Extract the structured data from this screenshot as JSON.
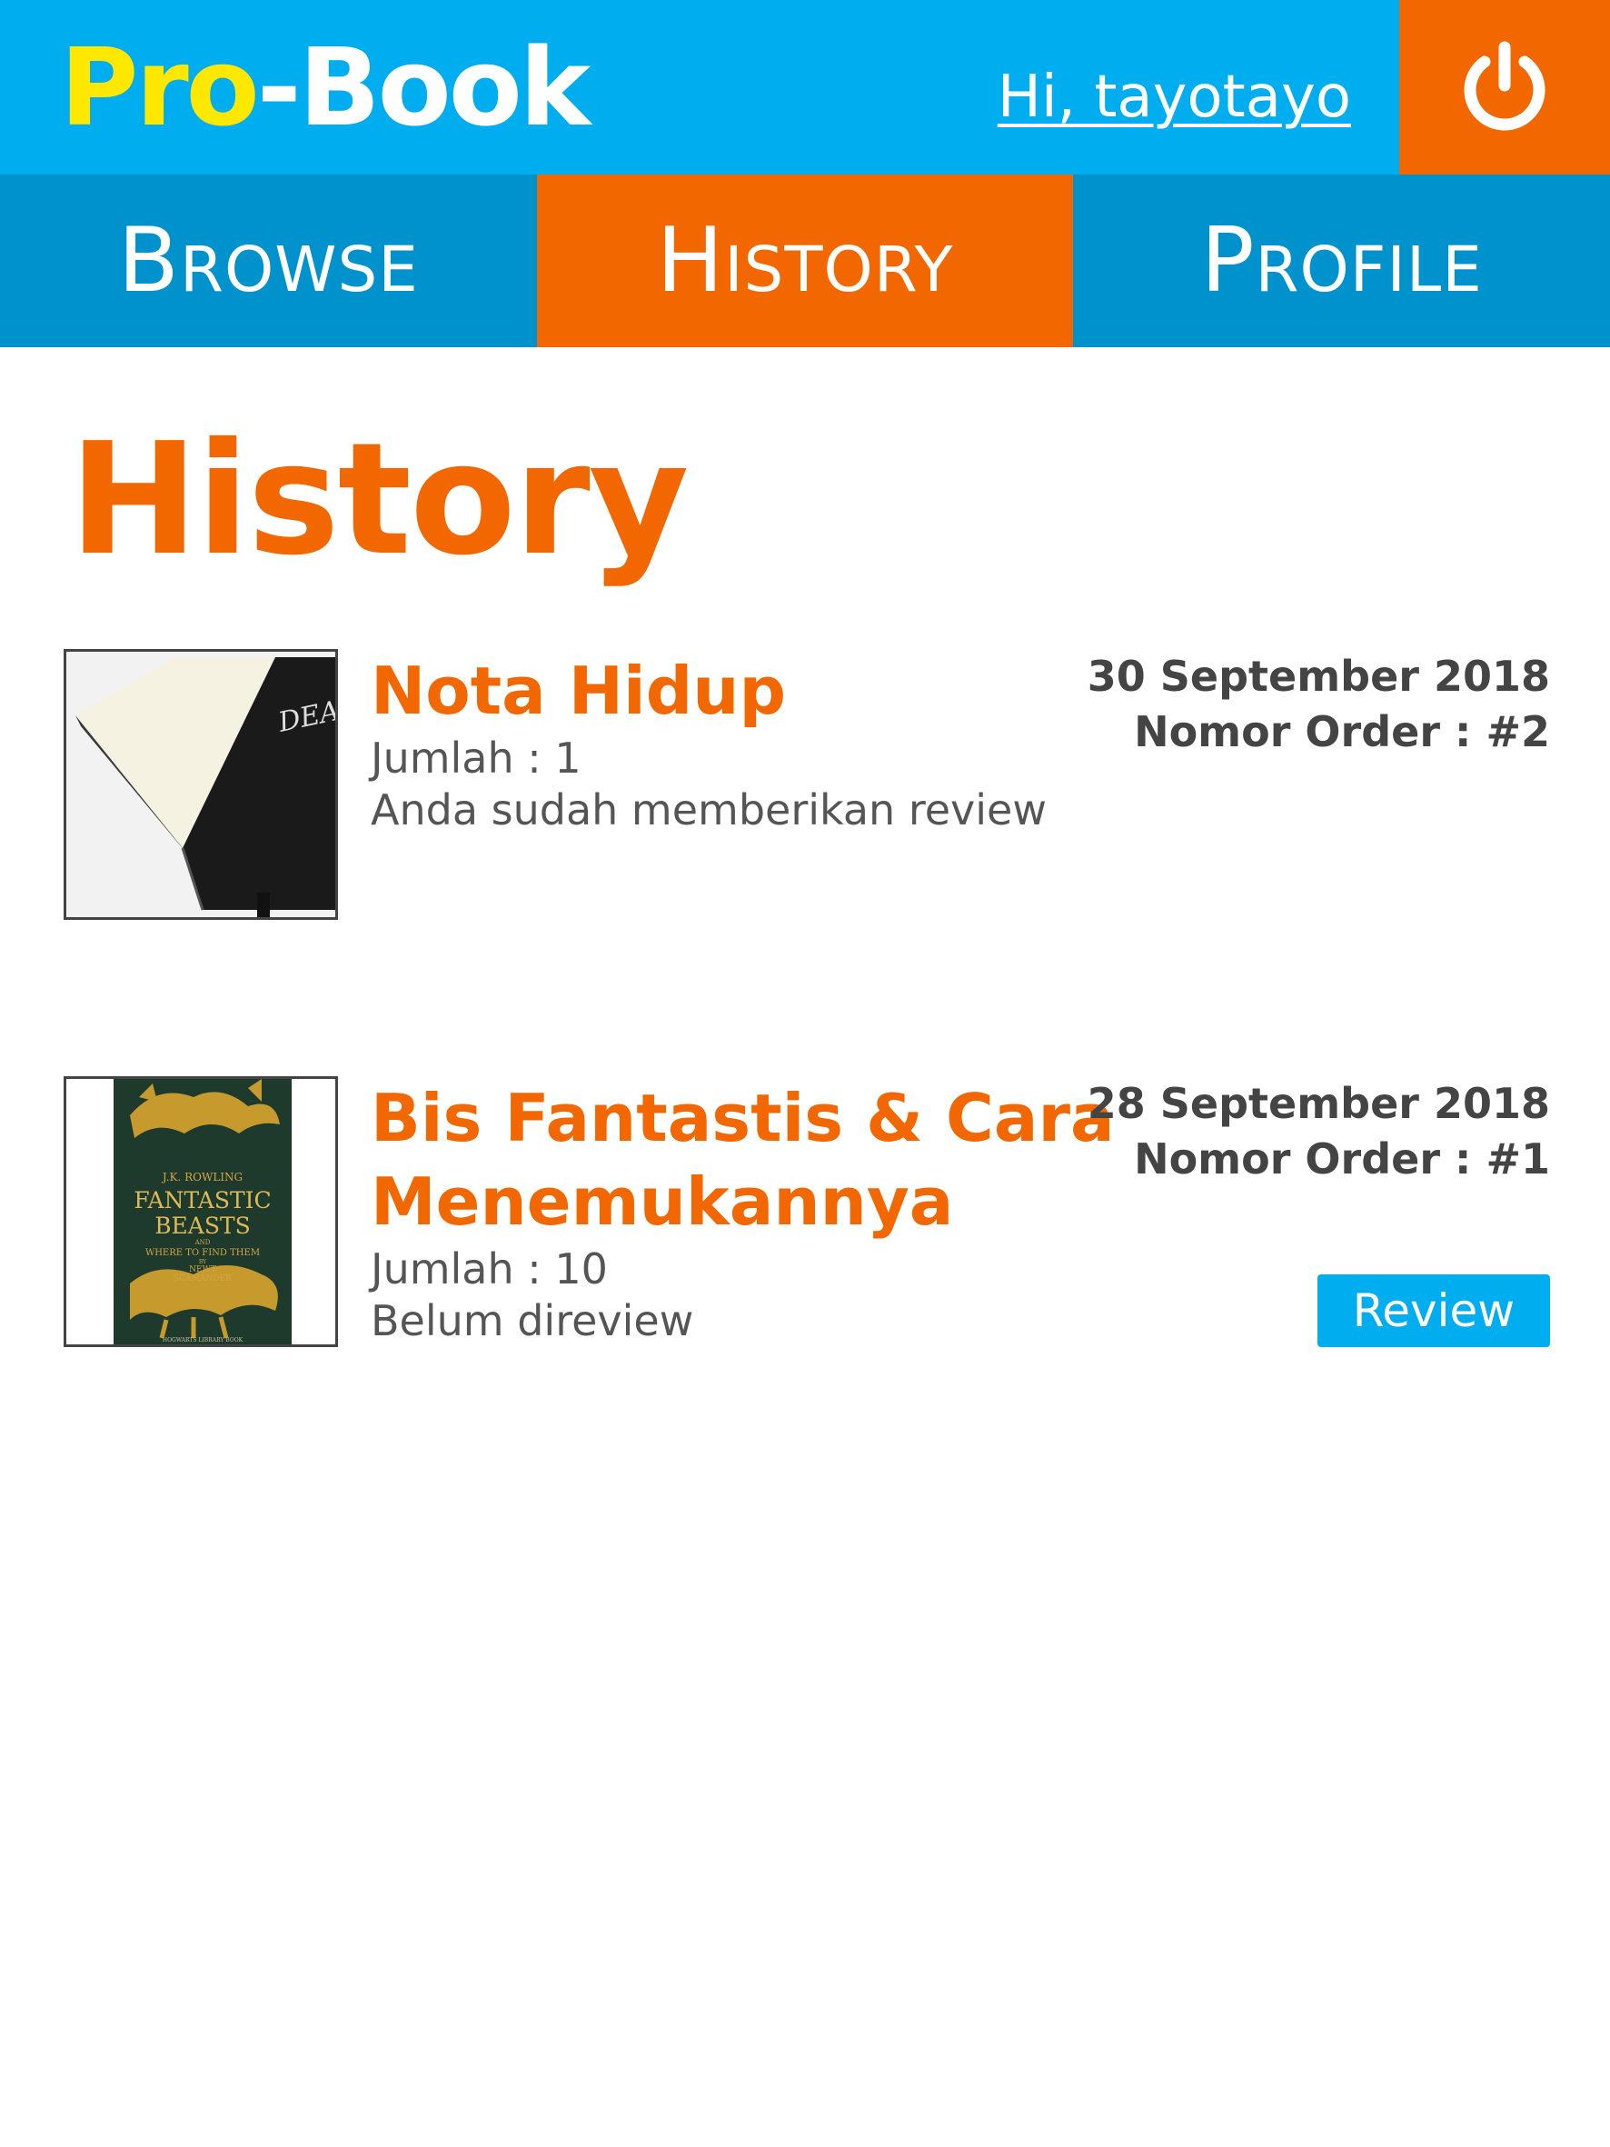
{
  "app": {
    "logo_pro": "Pro",
    "logo_dash": "-",
    "logo_book": "Book",
    "greeting": "Hi, tayotayo",
    "logout_icon": "power-icon"
  },
  "nav": {
    "tabs": [
      {
        "label": "Browse",
        "active": false
      },
      {
        "label": "History",
        "active": true
      },
      {
        "label": "Profile",
        "active": false
      }
    ]
  },
  "main": {
    "title": "History",
    "orders": [
      {
        "title": "Nota Hidup",
        "quantity": "Jumlah : 1",
        "review_status": "Anda sudah memberikan review",
        "date": "30 September 2018",
        "order_number": "Nomor Order : #2",
        "cover_text": "DEATH"
      },
      {
        "title": "Bis Fantastis & Cara Menemukannya",
        "quantity": "Jumlah : 10",
        "review_status": "Belum direview",
        "date": "28 September 2018",
        "order_number": "Nomor Order : #1",
        "review_button": "Review",
        "cover_author": "J.K. ROWLING",
        "cover_title_1": "FANTASTIC",
        "cover_title_2": "BEASTS",
        "cover_and": "AND",
        "cover_sub": "WHERE TO FIND THEM",
        "cover_by": "BY",
        "cover_name_1": "NEWT",
        "cover_name_2": "SCAMANDER",
        "cover_footer": "HOGWARTS LIBRARY BOOK"
      }
    ]
  },
  "colors": {
    "header": "#00adee",
    "nav": "#0092cc",
    "accent": "#f26700",
    "logo_yellow": "#ffe800"
  }
}
